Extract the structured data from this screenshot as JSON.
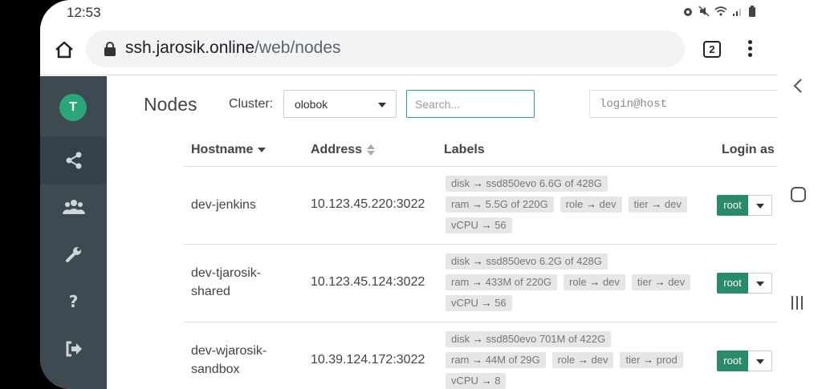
{
  "status": {
    "time": "12:53",
    "icons": [
      "alarm-icon",
      "mute-icon",
      "wifi-icon",
      "signal-icon",
      "battery-icon"
    ]
  },
  "browser": {
    "url_domain": "ssh.jarosik.online",
    "url_path": "/web/nodes",
    "tab_count": "2"
  },
  "sidebar": {
    "avatar_letter": "T",
    "items": [
      {
        "icon": "share-nodes-icon",
        "active": true
      },
      {
        "icon": "users-icon",
        "active": false
      },
      {
        "icon": "wrench-icon",
        "active": false
      },
      {
        "icon": "help-icon",
        "active": false
      },
      {
        "icon": "logout-icon",
        "active": false
      }
    ]
  },
  "page": {
    "title": "Nodes",
    "cluster_label": "Cluster:",
    "cluster_value": "olobok",
    "search_placeholder": "Search...",
    "login_placeholder": "login@host"
  },
  "table": {
    "headers": {
      "hostname": "Hostname",
      "address": "Address",
      "labels": "Labels",
      "login": "Login as"
    },
    "rows": [
      {
        "hostname_lines": [
          "dev-jenkins"
        ],
        "address": "10.123.45.220:3022",
        "labels": [
          {
            "key": "disk",
            "value": "ssd850evo 6.6G of 428G"
          },
          {
            "key": "ram",
            "value": "5.5G of 220G"
          },
          {
            "key": "role",
            "value": "dev"
          },
          {
            "key": "tier",
            "value": "dev"
          },
          {
            "key": "vCPU",
            "value": "56"
          }
        ],
        "login": "root"
      },
      {
        "hostname_lines": [
          "dev-tjarosik-",
          "shared"
        ],
        "address": "10.123.45.124:3022",
        "labels": [
          {
            "key": "disk",
            "value": "ssd850evo 6.2G of 428G"
          },
          {
            "key": "ram",
            "value": "433M of 220G"
          },
          {
            "key": "role",
            "value": "dev"
          },
          {
            "key": "tier",
            "value": "dev"
          },
          {
            "key": "vCPU",
            "value": "56"
          }
        ],
        "login": "root"
      },
      {
        "hostname_lines": [
          "dev-wjarosik-",
          "sandbox"
        ],
        "address": "10.39.124.172:3022",
        "labels": [
          {
            "key": "disk",
            "value": "ssd850evo 701M of 422G"
          },
          {
            "key": "ram",
            "value": "44M of 29G"
          },
          {
            "key": "role",
            "value": "dev"
          },
          {
            "key": "tier",
            "value": "prod"
          },
          {
            "key": "vCPU",
            "value": "8"
          }
        ],
        "login": "root"
      }
    ]
  },
  "colors": {
    "accent": "#2aa779",
    "root_button": "#2a8a6c",
    "sidebar": "#3e4a52",
    "label_bg": "#e4e6e8"
  }
}
